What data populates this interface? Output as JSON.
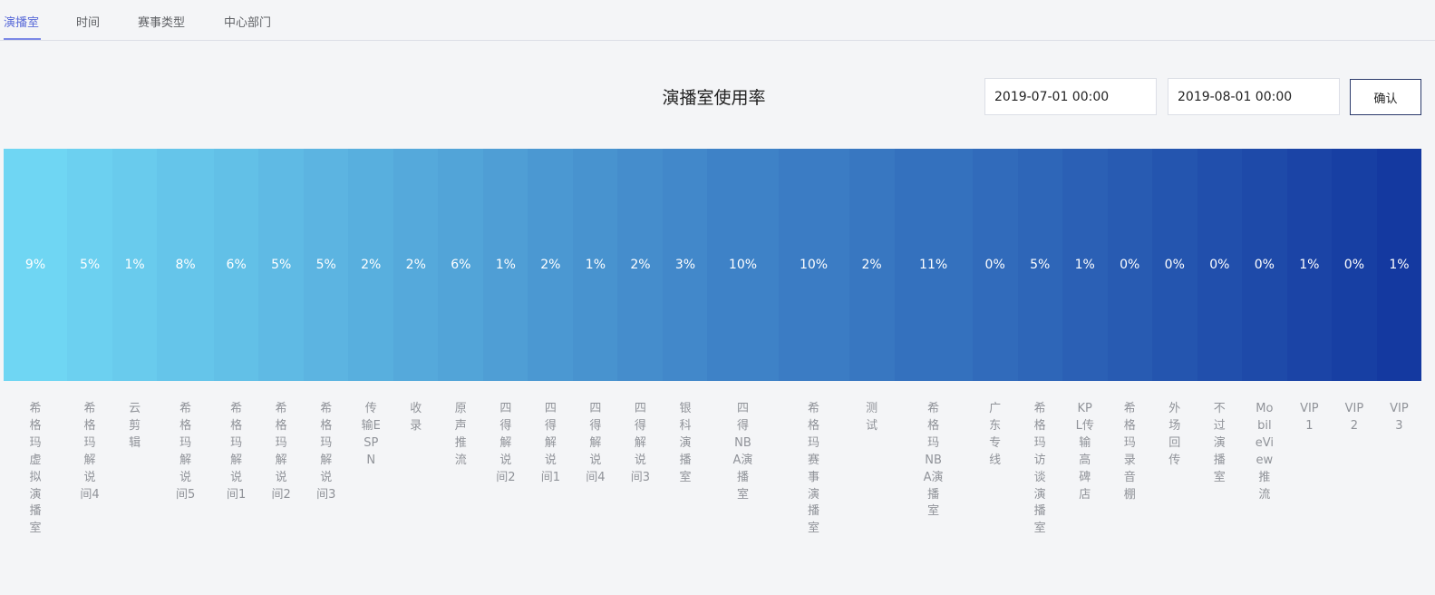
{
  "tabs": [
    {
      "label": "演播室",
      "active": true
    },
    {
      "label": "时间",
      "active": false
    },
    {
      "label": "赛事类型",
      "active": false
    },
    {
      "label": "中心部门",
      "active": false
    }
  ],
  "title": "演播室使用率",
  "filters": {
    "start_date": "2019-07-01 00:00",
    "end_date": "2019-08-01 00:00",
    "confirm_label": "确认"
  },
  "colors": {
    "gradient_start": "#6fd6f3",
    "gradient_end": "#1439a0",
    "value_text": "#ffffff",
    "label_text": "#909399",
    "active_tab": "#5a6bd8"
  },
  "chart_data": {
    "type": "bar",
    "categories": [
      "希格玛虚拟演播室",
      "希格玛解说间4",
      "云剪辑",
      "希格玛解说间5",
      "希格玛解说间1",
      "希格玛解说间2",
      "希格玛解说间3",
      "传输ESPN",
      "收录",
      "原声推流",
      "四得解说间2",
      "四得解说间1",
      "四得解说间4",
      "四得解说间3",
      "银科演播室",
      "四得NBA演播室",
      "希格玛赛事演播室",
      "测试",
      "希格玛NBA演播室",
      "广东专线",
      "希格玛访谈演播室",
      "KPL传输高碑店",
      "希格玛录音棚",
      "外场回传",
      "不过演播室",
      "MobileView推流",
      "VIP1",
      "VIP2",
      "VIP3"
    ],
    "values": [
      9,
      5,
      1,
      8,
      6,
      5,
      5,
      2,
      2,
      6,
      1,
      2,
      1,
      2,
      3,
      10,
      10,
      2,
      11,
      0,
      5,
      1,
      0,
      0,
      0,
      0,
      1,
      0,
      1
    ],
    "value_labels": [
      "9%",
      "5%",
      "1%",
      "8%",
      "6%",
      "5%",
      "5%",
      "2%",
      "2%",
      "6%",
      "1%",
      "2%",
      "1%",
      "2%",
      "3%",
      "10%",
      "10%",
      "2%",
      "11%",
      "0%",
      "5%",
      "1%",
      "0%",
      "0%",
      "0%",
      "0%",
      "1%",
      "0%",
      "1%"
    ],
    "unit": "%"
  }
}
